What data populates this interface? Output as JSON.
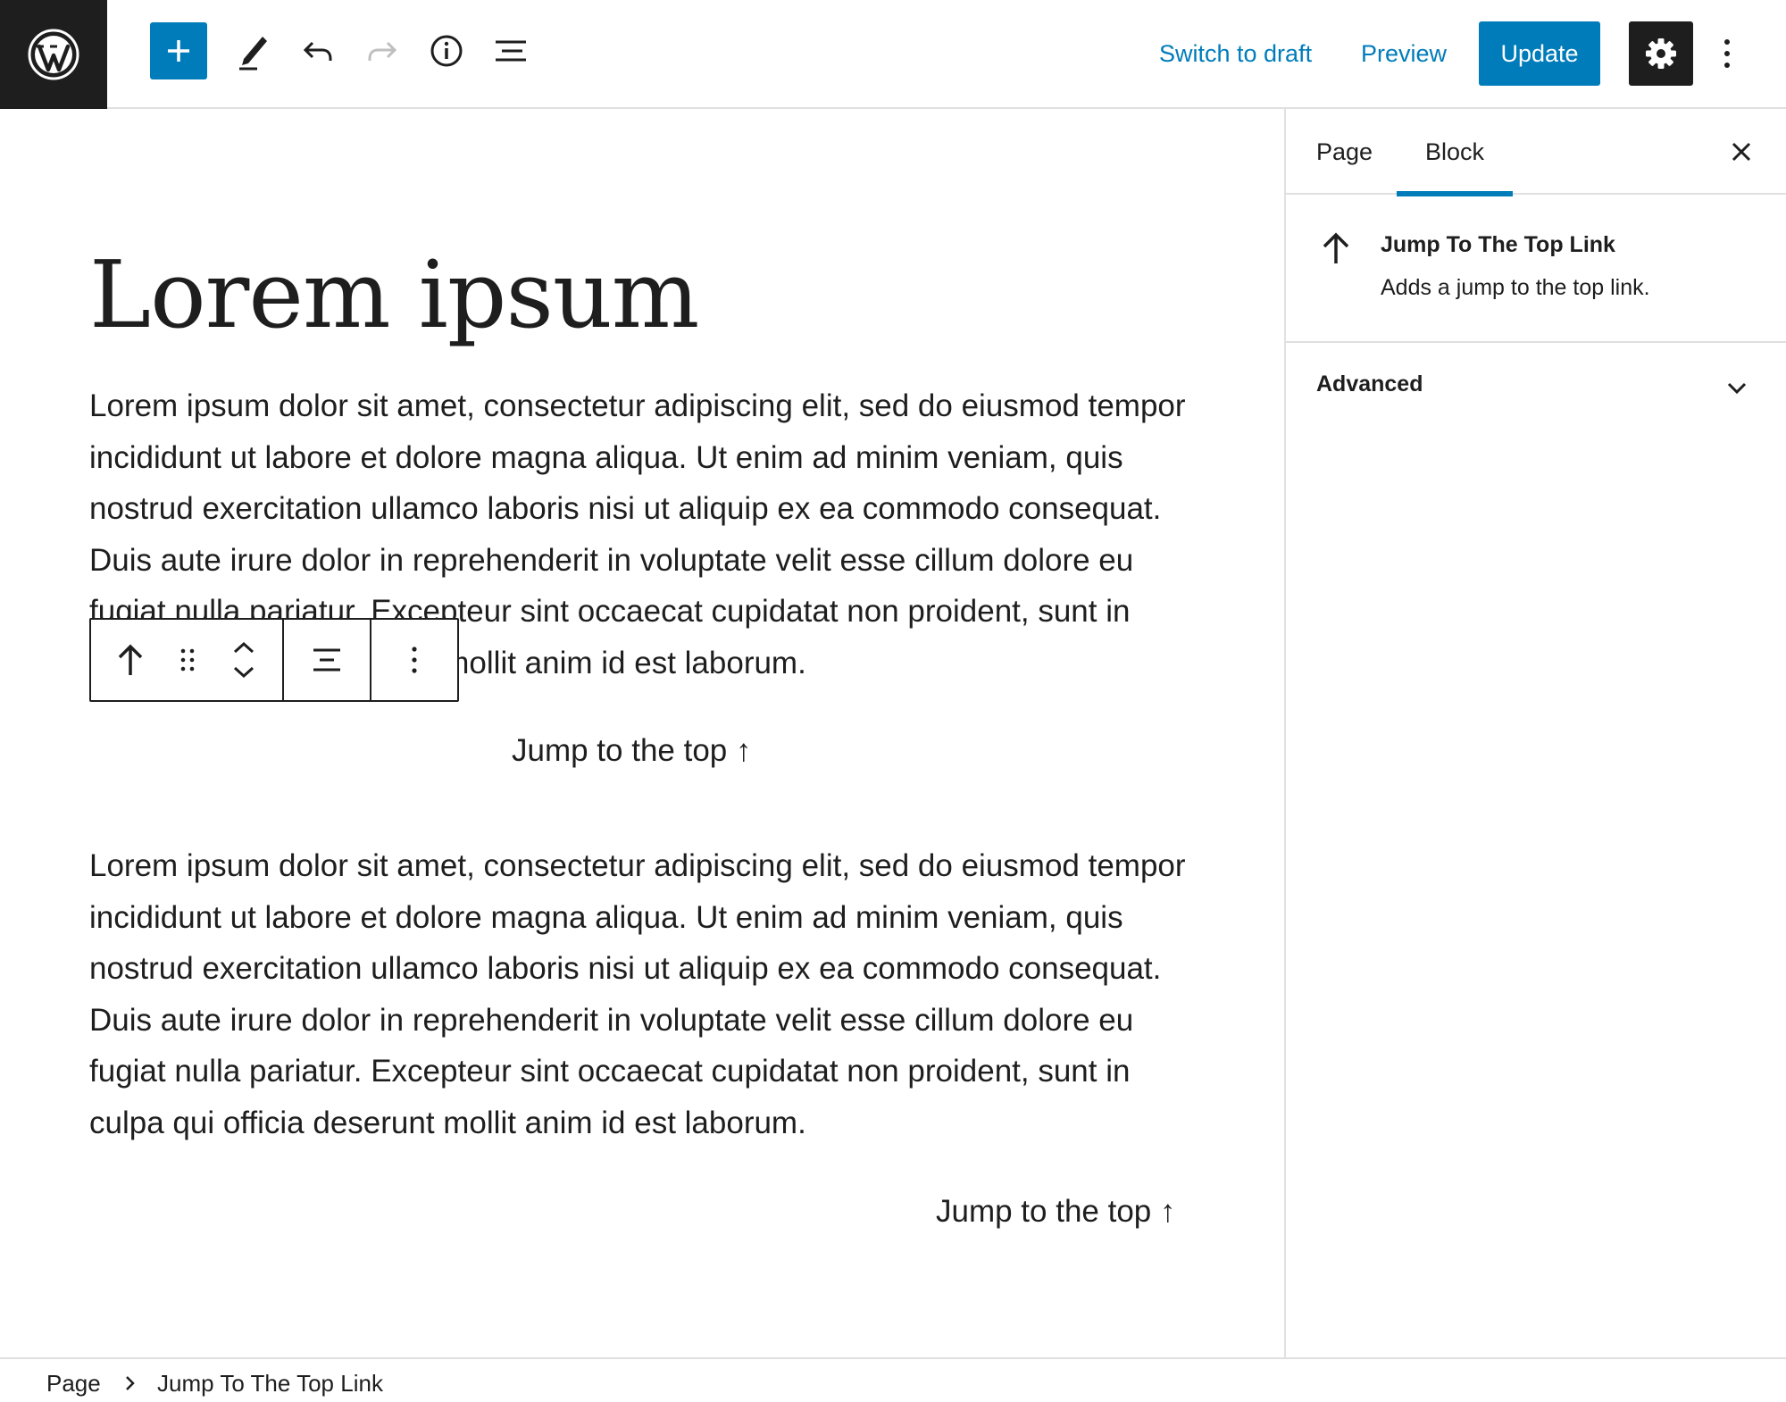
{
  "header": {
    "switch_to_draft": "Switch to draft",
    "preview": "Preview",
    "update": "Update"
  },
  "editor": {
    "title": "Lorem ipsum",
    "paragraph_1": "Lorem ipsum dolor sit amet, consectetur adipiscing elit, sed do eiusmod tempor incididunt ut labore et dolore magna aliqua. Ut enim ad minim veniam, quis nostrud exercitation ullamco laboris nisi ut aliquip ex ea commodo consequat. Duis aute irure dolor in reprehenderit in voluptate velit esse cillum dolore eu fugiat nulla pariatur. Excepteur sint occaecat cupidatat non proident, sunt in culpa qui officia deserunt mollit anim id est laborum.",
    "jump_link_1": "Jump to the top ↑",
    "paragraph_2": "Lorem ipsum dolor sit amet, consectetur adipiscing elit, sed do eiusmod tempor incididunt ut labore et dolore magna aliqua. Ut enim ad minim veniam, quis nostrud exercitation ullamco laboris nisi ut aliquip ex ea commodo consequat. Duis aute irure dolor in reprehenderit in voluptate velit esse cillum dolore eu fugiat nulla pariatur. Excepteur sint occaecat cupidatat non proident, sunt in culpa qui officia deserunt mollit anim id est laborum.",
    "jump_link_2": "Jump to the top ↑"
  },
  "sidebar": {
    "tabs": [
      {
        "label": "Page",
        "active": false
      },
      {
        "label": "Block",
        "active": true
      }
    ],
    "block_card": {
      "title": "Jump To The Top Link",
      "description": "Adds a jump to the top link."
    },
    "panels": [
      {
        "label": "Advanced",
        "expanded": false
      }
    ]
  },
  "breadcrumb": {
    "items": [
      "Page",
      "Jump To The Top Link"
    ]
  },
  "colors": {
    "accent": "#007cba",
    "dark": "#1e1e1e",
    "border": "#e0e0e0",
    "disabled": "#bfbfbf"
  },
  "icons": [
    "wordpress-logo-icon",
    "plus-icon",
    "pencil-icon",
    "undo-icon",
    "redo-icon",
    "info-icon",
    "list-view-icon",
    "gear-icon",
    "more-vertical-icon",
    "close-icon",
    "arrow-up-icon",
    "drag-handle-icon",
    "chevron-up-icon",
    "chevron-down-icon",
    "align-center-icon"
  ]
}
